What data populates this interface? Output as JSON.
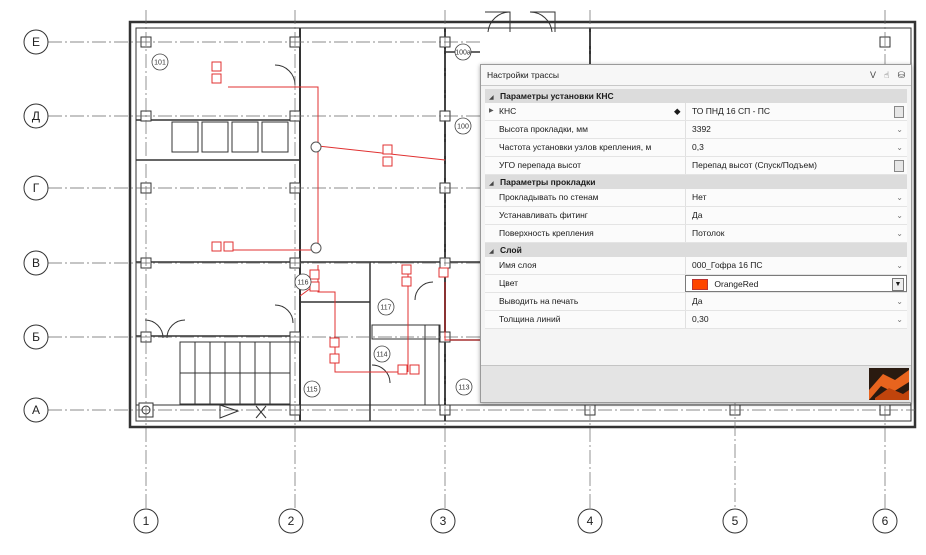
{
  "plan": {
    "row_axes": [
      "Е",
      "Д",
      "Г",
      "В",
      "Б",
      "А"
    ],
    "col_axes": [
      "1",
      "2",
      "3",
      "4",
      "5",
      "6"
    ],
    "rooms": [
      "101",
      "100",
      "100a",
      "115",
      "116",
      "117",
      "114",
      "113"
    ],
    "route_color": "#e03030"
  },
  "dialog": {
    "title": "Настройки трассы",
    "ctrl_labels": [
      "V"
    ],
    "sections": [
      {
        "label": "Параметры установки КНС",
        "rows": [
          {
            "name": "КНС",
            "value": "ТО ПНД 16 СП - ПС"
          },
          {
            "name": "Высота прокладки, мм",
            "value": "3392"
          },
          {
            "name": "Частота установки узлов крепления, м",
            "value": "0,3"
          },
          {
            "name": "УГО перепада высот",
            "value": "Перепад высот (Спуск/Подъем)"
          }
        ]
      },
      {
        "label": "Параметры прокладки",
        "rows": [
          {
            "name": "Прокладывать по стенам",
            "value": "Нет"
          },
          {
            "name": "Устанавливать фитинг",
            "value": "Да"
          },
          {
            "name": "Поверхность крепления",
            "value": "Потолок"
          }
        ]
      },
      {
        "label": "Слой",
        "rows": [
          {
            "name": "Имя слоя",
            "value": "000_Гофра 16 ПС"
          },
          {
            "name": "Цвет",
            "value": "OrangeRed"
          },
          {
            "name": "Выводить на печать",
            "value": "Да"
          },
          {
            "name": "Толщина линий",
            "value": "0,30"
          }
        ]
      }
    ],
    "color_swatch": "#FF4500"
  }
}
